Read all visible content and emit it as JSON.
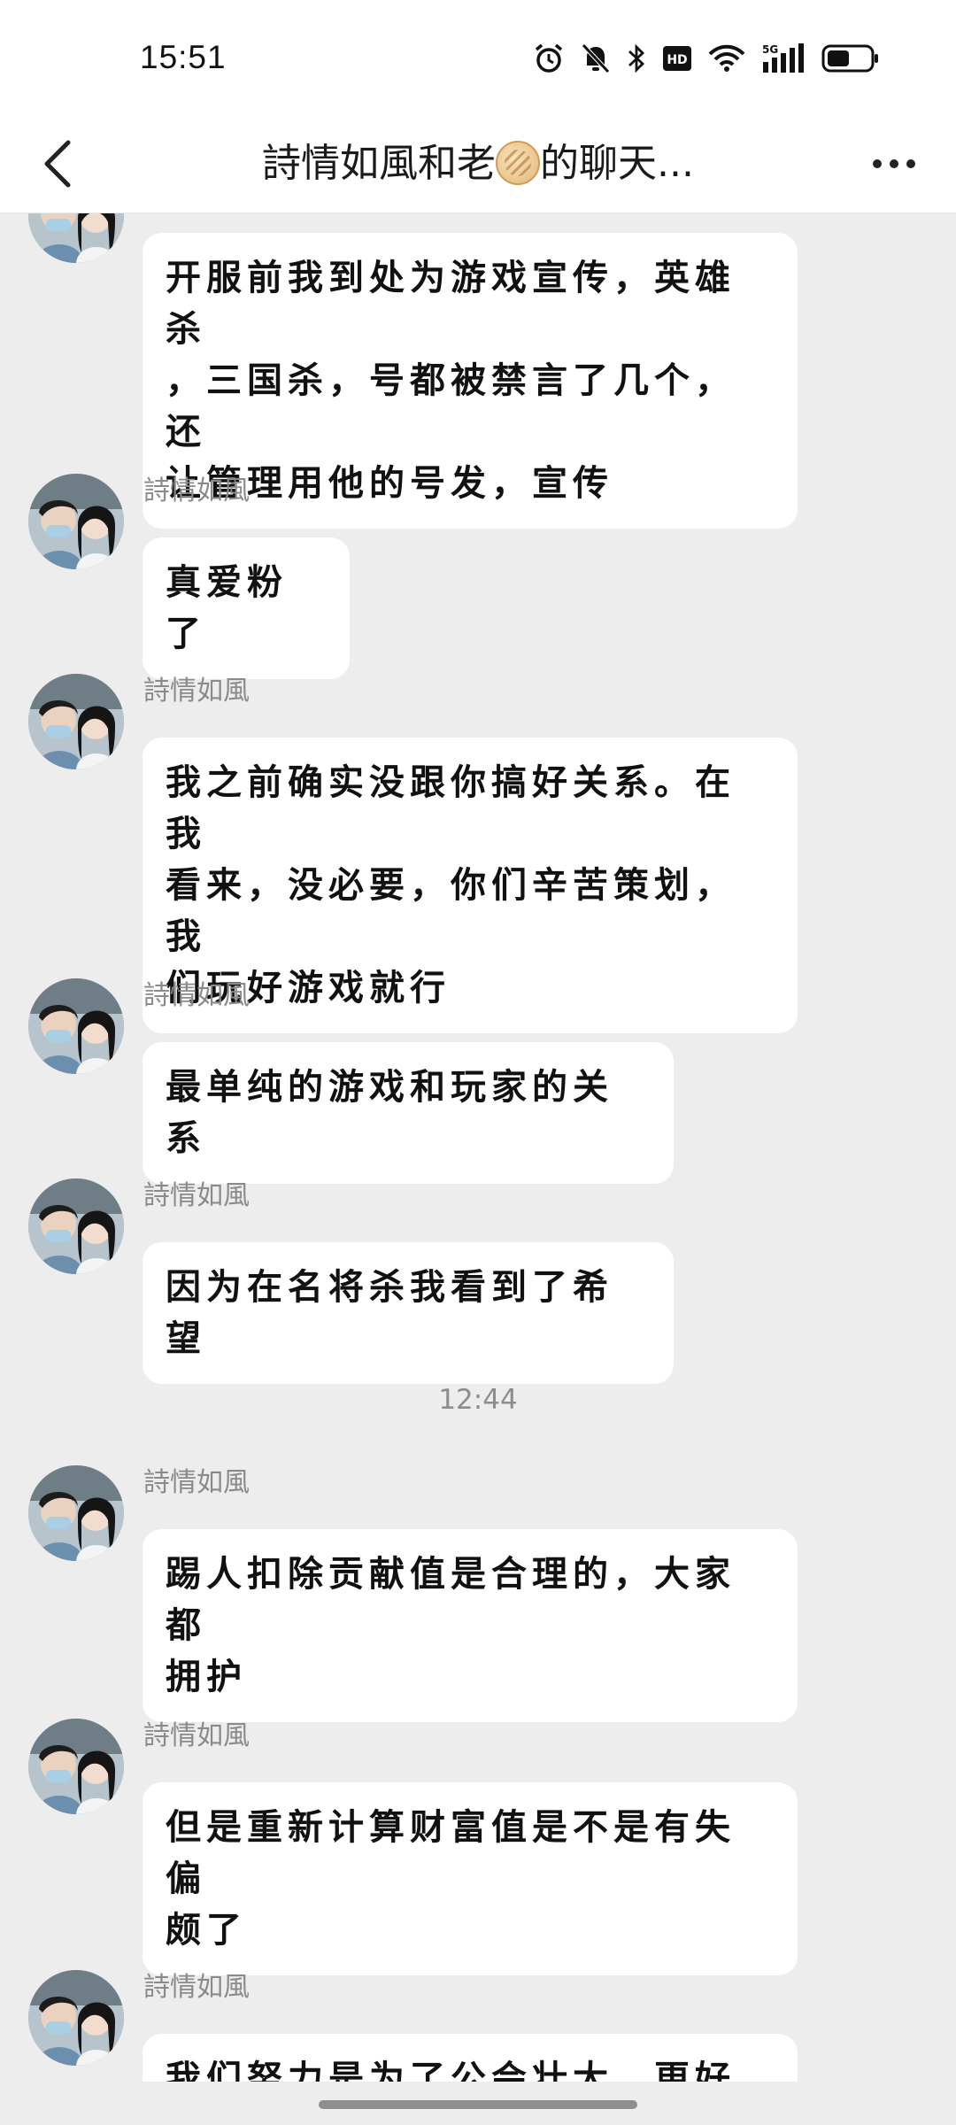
{
  "status_bar": {
    "time": "15:51",
    "icons": [
      "alarm-icon",
      "mute-icon",
      "bluetooth-icon",
      "hd-icon",
      "wifi-icon",
      "5g-signal-icon",
      "battery-icon"
    ]
  },
  "header": {
    "title_part1": "詩情如風和老",
    "title_part2": "的聊天...",
    "back_icon": "chevron-left-icon",
    "more_icon": "more-horizontal-icon"
  },
  "messages": [
    {
      "sender": "詩情如風",
      "lines": [
        "开服前我到处为游戏宣传，英雄杀",
        "，三国杀，号都被禁言了几个，还",
        "让管理用他的号发，宣传"
      ]
    },
    {
      "sender": "詩情如風",
      "lines": [
        "真爱粉了"
      ]
    },
    {
      "sender": "詩情如風",
      "lines": [
        "我之前确实没跟你搞好关系。在我",
        "看来，没必要，你们辛苦策划，我",
        "们玩好游戏就行"
      ]
    },
    {
      "sender": "詩情如風",
      "lines": [
        "最单纯的游戏和玩家的关系"
      ]
    },
    {
      "sender": "詩情如風",
      "lines": [
        "因为在名将杀我看到了希望"
      ]
    },
    {
      "sender": "詩情如風",
      "lines": [
        "踢人扣除贡献值是合理的，大家都",
        "拥护"
      ]
    },
    {
      "sender": "詩情如風",
      "lines": [
        "但是重新计算财富值是不是有失偏",
        "颇了"
      ]
    },
    {
      "sender": "詩情如風",
      "lines": [
        "我们努力是为了公会壮大，更好的"
      ]
    }
  ],
  "time_divider": "12:44"
}
